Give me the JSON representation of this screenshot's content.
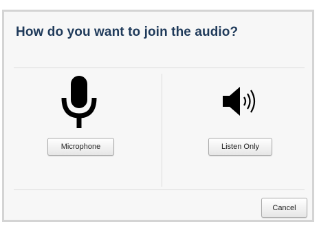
{
  "dialog": {
    "title": "How do you want to join the audio?"
  },
  "options": [
    {
      "icon": "microphone-icon",
      "button_label": "Microphone"
    },
    {
      "icon": "speaker-icon",
      "button_label": "Listen Only"
    }
  ],
  "footer": {
    "cancel_label": "Cancel"
  },
  "colors": {
    "title": "#1f3a5a",
    "dialog_background": "#f7f7f7",
    "dialog_border": "#d4d4d4",
    "icon": "#000000"
  }
}
